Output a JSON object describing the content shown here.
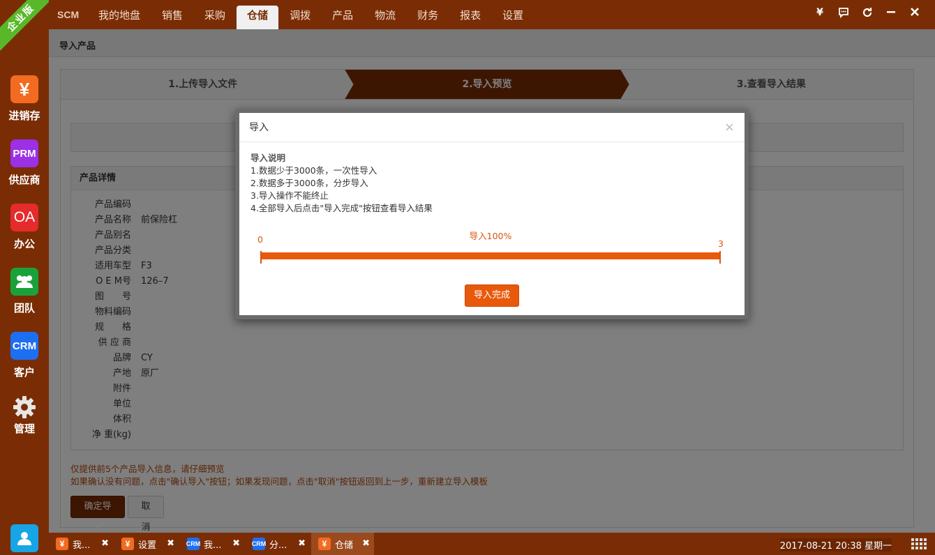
{
  "sidebar": {
    "ribbon": "企业版",
    "items": [
      {
        "icon_text": "¥",
        "label": "进销存",
        "color": "#f26b21"
      },
      {
        "icon_text": "PRM",
        "label": "供应商",
        "color": "#9b30e5"
      },
      {
        "icon_text": "OA",
        "label": "办公",
        "color": "#e52b2b"
      },
      {
        "icon_text": "",
        "label": "团队",
        "color": "#1aa23a",
        "icon": "team-icon"
      },
      {
        "icon_text": "CRM",
        "label": "客户",
        "color": "#1d6ff2"
      },
      {
        "icon_text": "",
        "label": "管理",
        "color": "transparent",
        "icon": "gear-icon"
      }
    ],
    "user_icon": "user-icon"
  },
  "topbar": {
    "brand": "SCM",
    "nav": [
      "我的地盘",
      "销售",
      "采购",
      "仓储",
      "调拨",
      "产品",
      "物流",
      "财务",
      "报表",
      "设置"
    ],
    "active_nav": "仓储",
    "actions": [
      "¥",
      "chat-icon",
      "refresh-icon",
      "minimize-icon",
      "close-icon"
    ]
  },
  "content": {
    "breadcrumb": "导入产品",
    "steps": [
      "1.上传导入文件",
      "2.导入预览",
      "3.查看导入结果"
    ],
    "active_step": 1,
    "detail": {
      "title": "产品详情",
      "rows": [
        {
          "k": "产品编码",
          "v": ""
        },
        {
          "k": "产品名称",
          "v": "前保险杠"
        },
        {
          "k": "产品别名",
          "v": ""
        },
        {
          "k": "产品分类",
          "v": ""
        },
        {
          "k": "适用车型",
          "v": "F3"
        },
        {
          "k": "O E M号",
          "v": "126–7"
        },
        {
          "k": "图　　号",
          "v": ""
        },
        {
          "k": "物料编码",
          "v": ""
        },
        {
          "k": "规　　格",
          "v": ""
        },
        {
          "k": "供 应 商",
          "v": ""
        },
        {
          "k": "品牌",
          "v": "CY"
        },
        {
          "k": "产地",
          "v": "原厂"
        },
        {
          "k": "附件",
          "v": ""
        },
        {
          "k": "单位",
          "v": ""
        },
        {
          "k": "体积",
          "v": ""
        },
        {
          "k": "净 重(kg)",
          "v": ""
        }
      ]
    },
    "note1": "仅提供前5个产品导入信息，请仔细预览",
    "note2": "如果确认没有问题，点击\"确认导入\"按钮；如果发现问题，点击\"取消\"按钮返回到上一步，重新建立导入模板",
    "confirm_label": "确定导入",
    "cancel_label": "取消"
  },
  "modal": {
    "title": "导入",
    "close": "×",
    "desc_title": "导入说明",
    "lines": [
      "1.数据少于3000条，一次性导入",
      "2.数据多于3000条，分步导入",
      "3.导入操作不能终止",
      "4.全部导入后点击\"导入完成\"按钮查看导入结果"
    ],
    "progress": {
      "min": "0",
      "max": "3",
      "label": "导入100%",
      "percent": 100
    },
    "done_label": "导入完成"
  },
  "taskbar": {
    "tasks": [
      {
        "icon": "¥",
        "label": "我...",
        "color": "#f26b21"
      },
      {
        "icon": "¥",
        "label": "设置",
        "color": "#f26b21"
      },
      {
        "icon": "CRM",
        "label": "我...",
        "color": "#1d6ff2"
      },
      {
        "icon": "CRM",
        "label": "分...",
        "color": "#1d6ff2"
      },
      {
        "icon": "¥",
        "label": "仓储",
        "color": "#f26b21",
        "active": true
      }
    ],
    "clock": "2017-08-21 20:38 星期一"
  }
}
